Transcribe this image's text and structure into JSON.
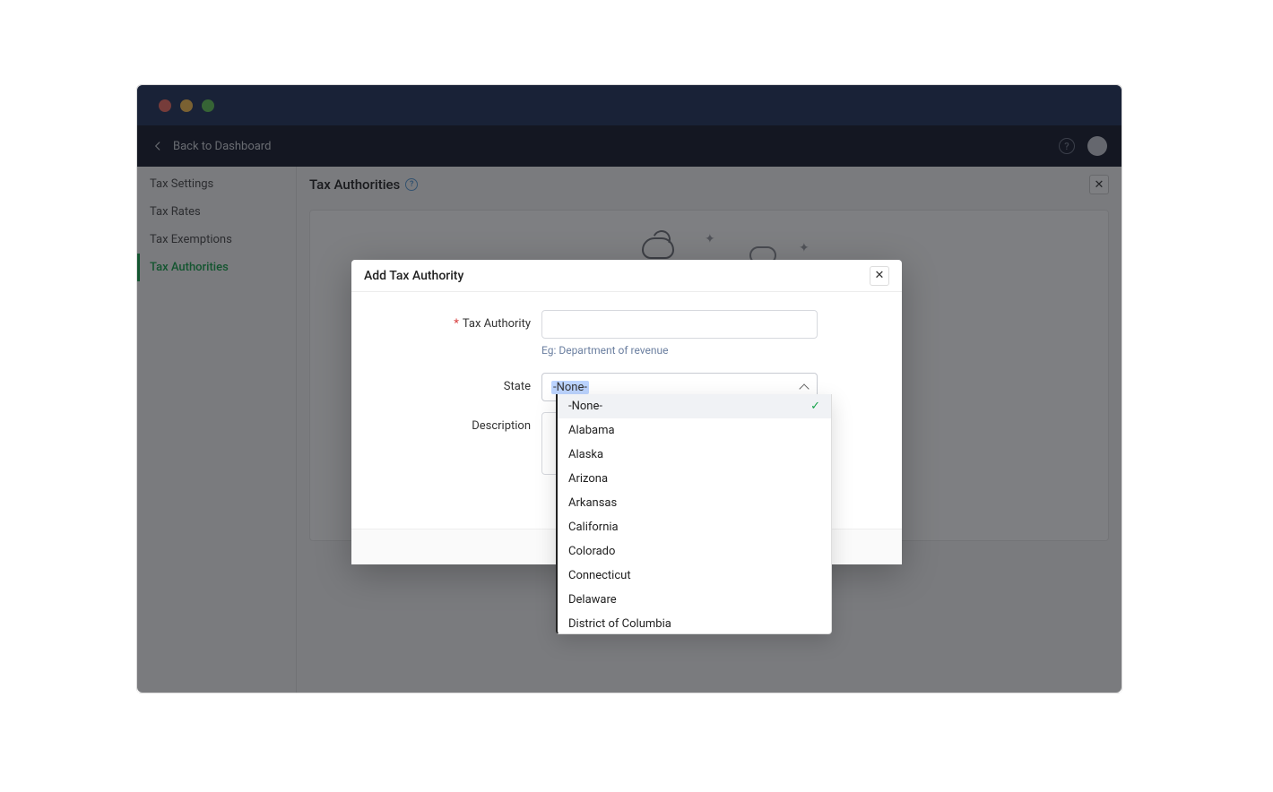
{
  "window": {
    "back_label": "Back to Dashboard",
    "help_tooltip": "?",
    "traffic_lights": [
      "red",
      "yellow",
      "green"
    ]
  },
  "sidebar": {
    "items": [
      {
        "label": "Tax Settings",
        "active": false
      },
      {
        "label": "Tax Rates",
        "active": false
      },
      {
        "label": "Tax Exemptions",
        "active": false
      },
      {
        "label": "Tax Authorities",
        "active": true
      }
    ]
  },
  "page": {
    "title": "Tax Authorities"
  },
  "modal": {
    "title": "Add Tax Authority",
    "fields": {
      "tax_authority": {
        "label": "Tax Authority",
        "required": true,
        "value": "",
        "hint": "Eg: Department of revenue"
      },
      "state": {
        "label": "State",
        "selected": "-None-",
        "options": [
          "-None-",
          "Alabama",
          "Alaska",
          "Arizona",
          "Arkansas",
          "California",
          "Colorado",
          "Connecticut",
          "Delaware",
          "District of Columbia"
        ]
      },
      "description": {
        "label": "Description",
        "value": ""
      }
    }
  }
}
